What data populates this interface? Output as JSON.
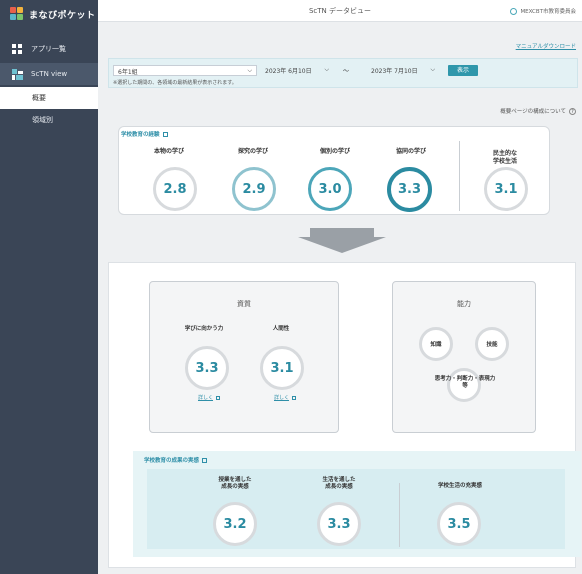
{
  "app": {
    "name": "まなびポケット",
    "page_title": "ScTN データビュー",
    "org": "MEXCBT市教育委員会",
    "manual_link": "マニュアルダウンロード"
  },
  "sidebar": {
    "items": [
      {
        "label": "アプリ一覧",
        "icon": "apps-grid-icon"
      },
      {
        "label": "ScTN view",
        "icon": "sctn-view-icon"
      }
    ],
    "sub_items": [
      {
        "label": "概要"
      },
      {
        "label": "領域別"
      }
    ]
  },
  "filter": {
    "class_select": "6年1組",
    "date_from": "2023年 6月10日",
    "date_to": "2023年 7月10日",
    "range_sep": "〜",
    "show_button": "表示",
    "note": "※選択した期間の、各領域の最新結果が表示されます。"
  },
  "about_link": "概要ページの構成について",
  "experience": {
    "heading": "学校教育の経験",
    "metrics": [
      {
        "label": "本物の学び",
        "value": "2.8"
      },
      {
        "label": "探究の学び",
        "value": "2.9"
      },
      {
        "label": "個別の学び",
        "value": "3.0"
      },
      {
        "label": "協同の学び",
        "value": "3.3"
      },
      {
        "label": "民主的な\n学校生活",
        "value": "3.1"
      }
    ]
  },
  "qualities": {
    "title": "資質",
    "items": [
      {
        "label": "学びに向かう力",
        "value": "3.3",
        "link": "詳しく"
      },
      {
        "label": "人間性",
        "value": "3.1",
        "link": "詳しく"
      }
    ]
  },
  "abilities": {
    "title": "能力",
    "items": [
      {
        "label": "知識"
      },
      {
        "label": "技能"
      },
      {
        "label": "思考力・判断力・表現力\n等"
      }
    ]
  },
  "results": {
    "heading": "学校教育の成果の実感",
    "metrics": [
      {
        "label": "授業を通した\n成長の実感",
        "value": "3.2"
      },
      {
        "label": "生活を通した\n成長の実感",
        "value": "3.3"
      },
      {
        "label": "学校生活の充実感",
        "value": "3.5"
      }
    ]
  },
  "colors": {
    "accent": "#2f97ab",
    "sidebar": "#3a4556",
    "ring_dark": "#2b8ba1",
    "ring_light": "#8fc3cf",
    "ring_gray": "#d7dadd"
  }
}
